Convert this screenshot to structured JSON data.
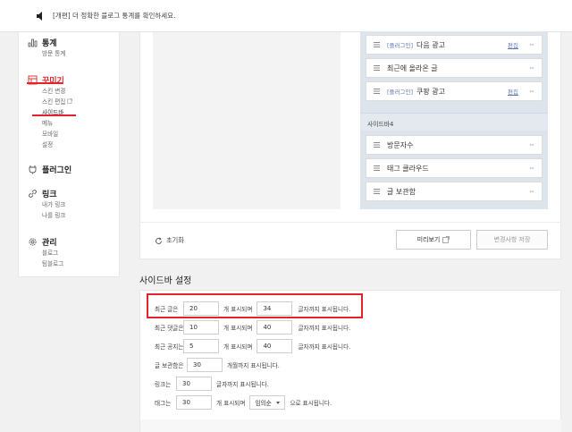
{
  "notice": {
    "text": "[개편] 더 정확한 블로그 통계를 확인하세요."
  },
  "sidebar": {
    "stats": {
      "title": "통계",
      "items": [
        "방문 통계"
      ]
    },
    "decorate": {
      "title": "꾸미기",
      "items": [
        "스킨 변경",
        "스킨 편집",
        "사이드바",
        "메뉴",
        "모바일",
        "설정"
      ]
    },
    "plugin": {
      "title": "플러그인"
    },
    "link": {
      "title": "링크",
      "items": [
        "내가 링크",
        "나를 링크"
      ]
    },
    "manage": {
      "title": "관리",
      "items": [
        "블로그",
        "팀블로그"
      ]
    }
  },
  "sidebar_editor": {
    "slots_top": [
      {
        "plugin": "[플러그인]",
        "name": "다음 광고",
        "edit": "편집"
      },
      {
        "plugin": "",
        "name": "최근에 올라온 글",
        "edit": ""
      },
      {
        "plugin": "[플러그인]",
        "name": "쿠팡 광고",
        "edit": "편집"
      }
    ],
    "section_title": "사이드바4",
    "slots_bottom": [
      {
        "name": "방문자수"
      },
      {
        "name": "태그 클라우드"
      },
      {
        "name": "글 보관함"
      }
    ],
    "more_label": "···",
    "reset_label": "초기화",
    "preview_label": "미리보기",
    "save_label": "변경사항 저장"
  },
  "settings": {
    "title": "사이드바 설정",
    "recent_posts": {
      "label": "최근 글은",
      "count": "20",
      "mid": "개 표시되며",
      "chars": "34",
      "suffix": "글자까지 표시됩니다."
    },
    "recent_comments": {
      "label": "최근 댓글은",
      "count": "10",
      "mid": "개 표시되며",
      "chars": "40",
      "suffix": "글자까지 표시됩니다."
    },
    "recent_notices": {
      "label": "최근 공지는",
      "count": "5",
      "mid": "개 표시되며",
      "chars": "40",
      "suffix": "글자까지 표시됩니다."
    },
    "archive": {
      "label": "글 보관함은",
      "count": "30",
      "suffix": "개월까지 표시됩니다."
    },
    "links": {
      "label": "링크는",
      "count": "30",
      "suffix": "글자까지 표시됩니다."
    },
    "tags": {
      "label": "태그는",
      "count": "30",
      "mid": "개 표시되며",
      "order": "임의순",
      "suffix": "으로 표시됩니다."
    }
  },
  "colors": {
    "highlight": "#e0242a",
    "accent": "#6479b4"
  }
}
